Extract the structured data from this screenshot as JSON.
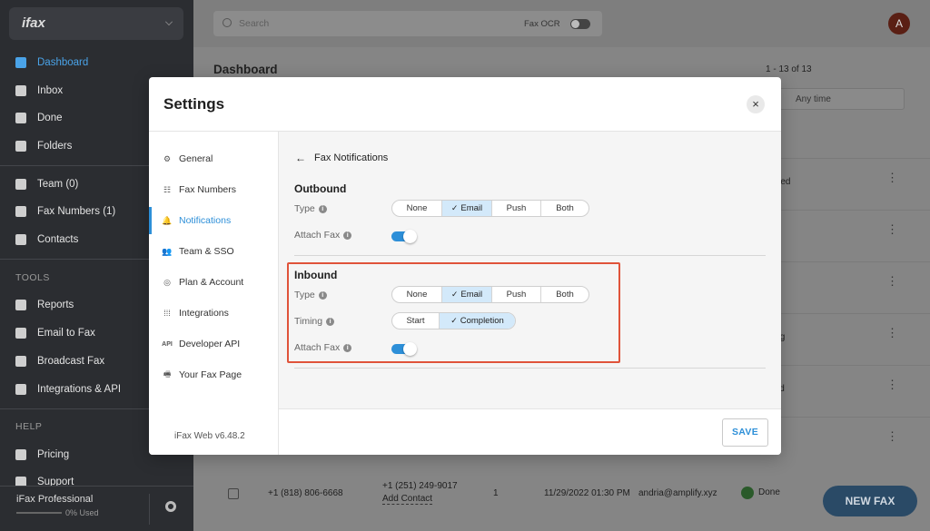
{
  "app": {
    "brand": "ifax",
    "sidebar": {
      "items": [
        {
          "label": "Dashboard",
          "icon": "home-icon"
        },
        {
          "label": "Inbox",
          "icon": "inbox-icon"
        },
        {
          "label": "Done",
          "icon": "done-folder-icon"
        },
        {
          "label": "Folders",
          "icon": "folder-icon"
        },
        {
          "label": "Team (0)",
          "icon": "team-icon"
        },
        {
          "label": "Fax Numbers (1)",
          "icon": "dialpad-icon"
        },
        {
          "label": "Contacts",
          "icon": "contacts-icon"
        }
      ],
      "tools_heading": "TOOLS",
      "tools": [
        {
          "label": "Reports",
          "icon": "bar-chart-icon"
        },
        {
          "label": "Email to Fax",
          "icon": "mail-icon"
        },
        {
          "label": "Broadcast Fax",
          "icon": "megaphone-icon"
        },
        {
          "label": "Integrations & API",
          "icon": "grid-icon"
        }
      ],
      "help_heading": "HELP",
      "help": [
        {
          "label": "Pricing",
          "icon": "toggle-icon"
        },
        {
          "label": "Support",
          "icon": "support-icon"
        }
      ],
      "plan": "iFax Professional",
      "usage": "0% Used"
    },
    "topbar": {
      "search_placeholder": "Search",
      "fax_ocr_label": "Fax OCR",
      "avatar_initial": "A"
    },
    "dashboard": {
      "title": "Dashboard",
      "pagination": "1 - 13 of 13",
      "time_filter": "Any time",
      "row_statuses": [
        "signed",
        "",
        "",
        "ssing",
        "rmed",
        ""
      ],
      "last_row": {
        "from": "+1 (818) 806-6668",
        "to": "+1 (251) 249-9017",
        "add_contact": "Add Contact",
        "pages": "1",
        "datetime": "11/29/2022 01:30 PM",
        "email": "andria@amplify.xyz",
        "status": "Done"
      },
      "new_fax_label": "NEW FAX"
    }
  },
  "settings": {
    "title": "Settings",
    "close_symbol": "×",
    "menu": [
      {
        "label": "General",
        "icon": "gear-icon",
        "glyph": "⚙"
      },
      {
        "label": "Fax Numbers",
        "icon": "fax-number-icon",
        "glyph": "☷"
      },
      {
        "label": "Notifications",
        "icon": "bell-icon",
        "glyph": "🔔"
      },
      {
        "label": "Team & SSO",
        "icon": "team-icon",
        "glyph": "👥"
      },
      {
        "label": "Plan & Account",
        "icon": "account-icon",
        "glyph": "◎"
      },
      {
        "label": "Integrations",
        "icon": "grid-icon",
        "glyph": "⁞⁞⁞"
      },
      {
        "label": "Developer API",
        "icon": "api-icon",
        "glyph": "API"
      },
      {
        "label": "Your Fax Page",
        "icon": "fax-machine-icon",
        "glyph": "🖷"
      }
    ],
    "active_menu": "Notifications",
    "version": "iFax Web v6.48.2",
    "panel": {
      "back_label": "Fax Notifications",
      "outbound": {
        "title": "Outbound",
        "type_label": "Type",
        "type_options": [
          "None",
          "Email",
          "Push",
          "Both"
        ],
        "type_selected": "Email",
        "attach_label": "Attach Fax",
        "attach_on": true
      },
      "inbound": {
        "title": "Inbound",
        "type_label": "Type",
        "type_options": [
          "None",
          "Email",
          "Push",
          "Both"
        ],
        "type_selected": "Email",
        "timing_label": "Timing",
        "timing_options": [
          "Start",
          "Completion"
        ],
        "timing_selected": "Completion",
        "attach_label": "Attach Fax",
        "attach_on": true
      }
    },
    "save_label": "SAVE",
    "colors": {
      "accent": "#2d8fd8",
      "selected_bg": "#d3e9fa",
      "highlight": "#e0533a"
    }
  }
}
